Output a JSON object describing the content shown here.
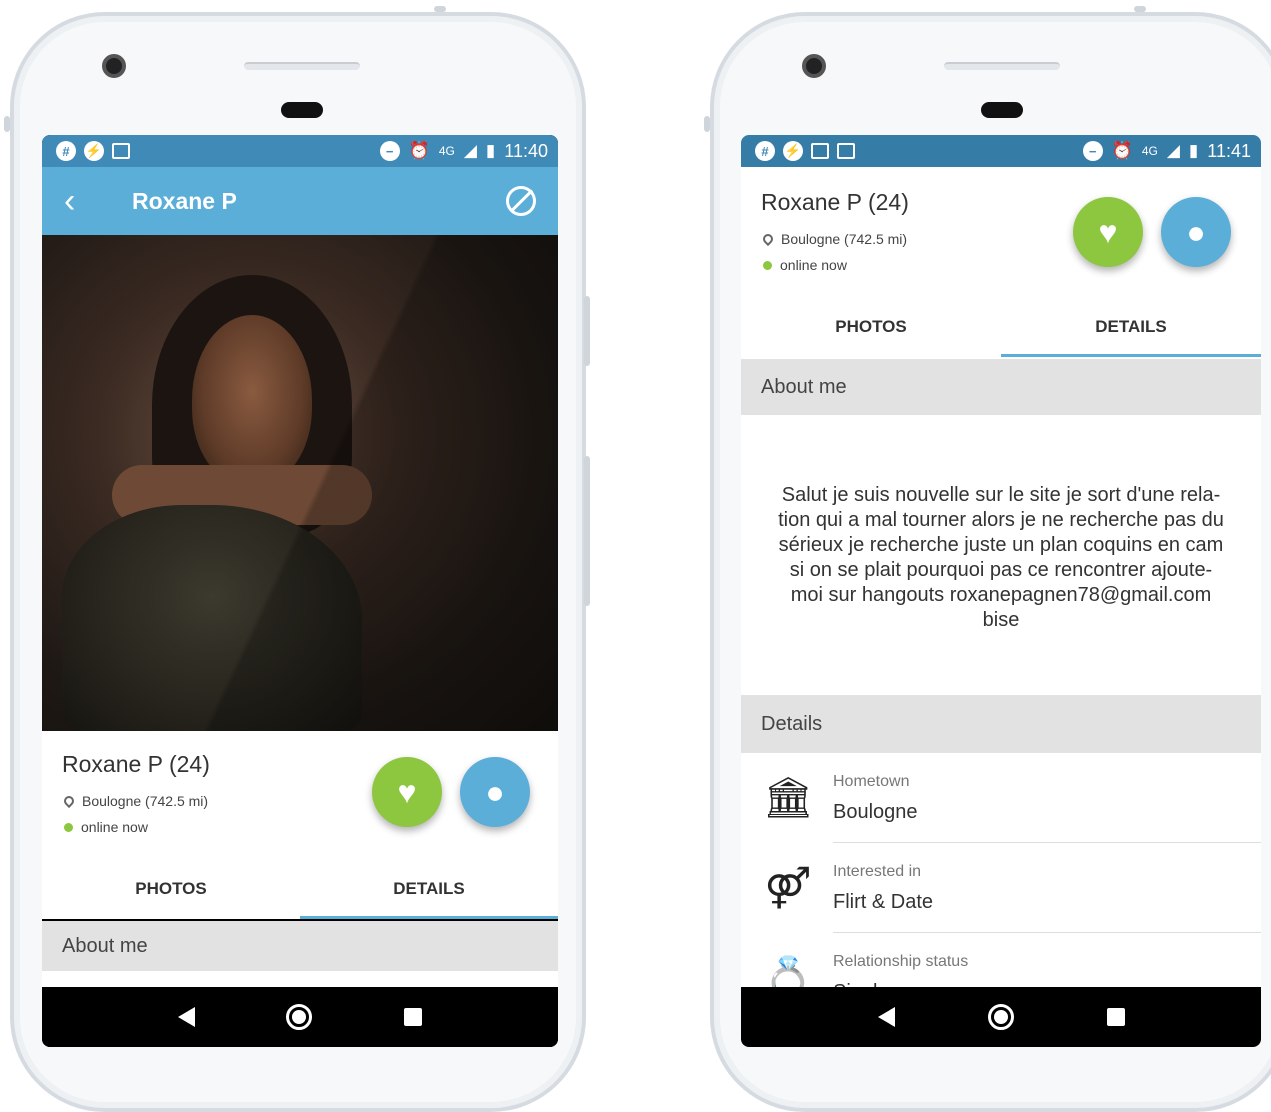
{
  "colors": {
    "accent": "#5aaed8",
    "status_bar": "#3f8ab6",
    "like": "#8dc63f",
    "online": "#8dc63f"
  },
  "left": {
    "status": {
      "time": "11:40",
      "network": "4G"
    },
    "appbar": {
      "title": "Roxane P"
    },
    "profile": {
      "name": "Roxane P (24)",
      "location": "Boulogne (742.5 mi)",
      "online": "online now"
    },
    "tabs": [
      "PHOTOS",
      "DETAILS"
    ],
    "active_tab": "DETAILS",
    "section": "About me"
  },
  "right": {
    "status": {
      "time": "11:41",
      "network": "4G"
    },
    "profile": {
      "name": "Roxane P (24)",
      "location": "Boulogne (742.5 mi)",
      "online": "online now"
    },
    "tabs": [
      "PHOTOS",
      "DETAILS"
    ],
    "active_tab": "DETAILS",
    "about_title": "About me",
    "about_text": "Salut je suis nouvelle sur le site je sort d'une rela-\ntion qui a mal tourner alors je ne recherche pas du\nsérieux je recherche juste un plan coquins en cam\nsi on se plait pourquoi pas ce rencontrer ajoute-\nmoi sur hangouts roxanepagnen78@gmail.com\nbise",
    "details_title": "Details",
    "details": [
      {
        "label": "Hometown",
        "value": "Boulogne",
        "icon": "building-icon"
      },
      {
        "label": "Interested in",
        "value": "Flirt & Date",
        "icon": "gender-icon"
      },
      {
        "label": "Relationship status",
        "value": "Single",
        "icon": "ring-icon"
      }
    ]
  }
}
